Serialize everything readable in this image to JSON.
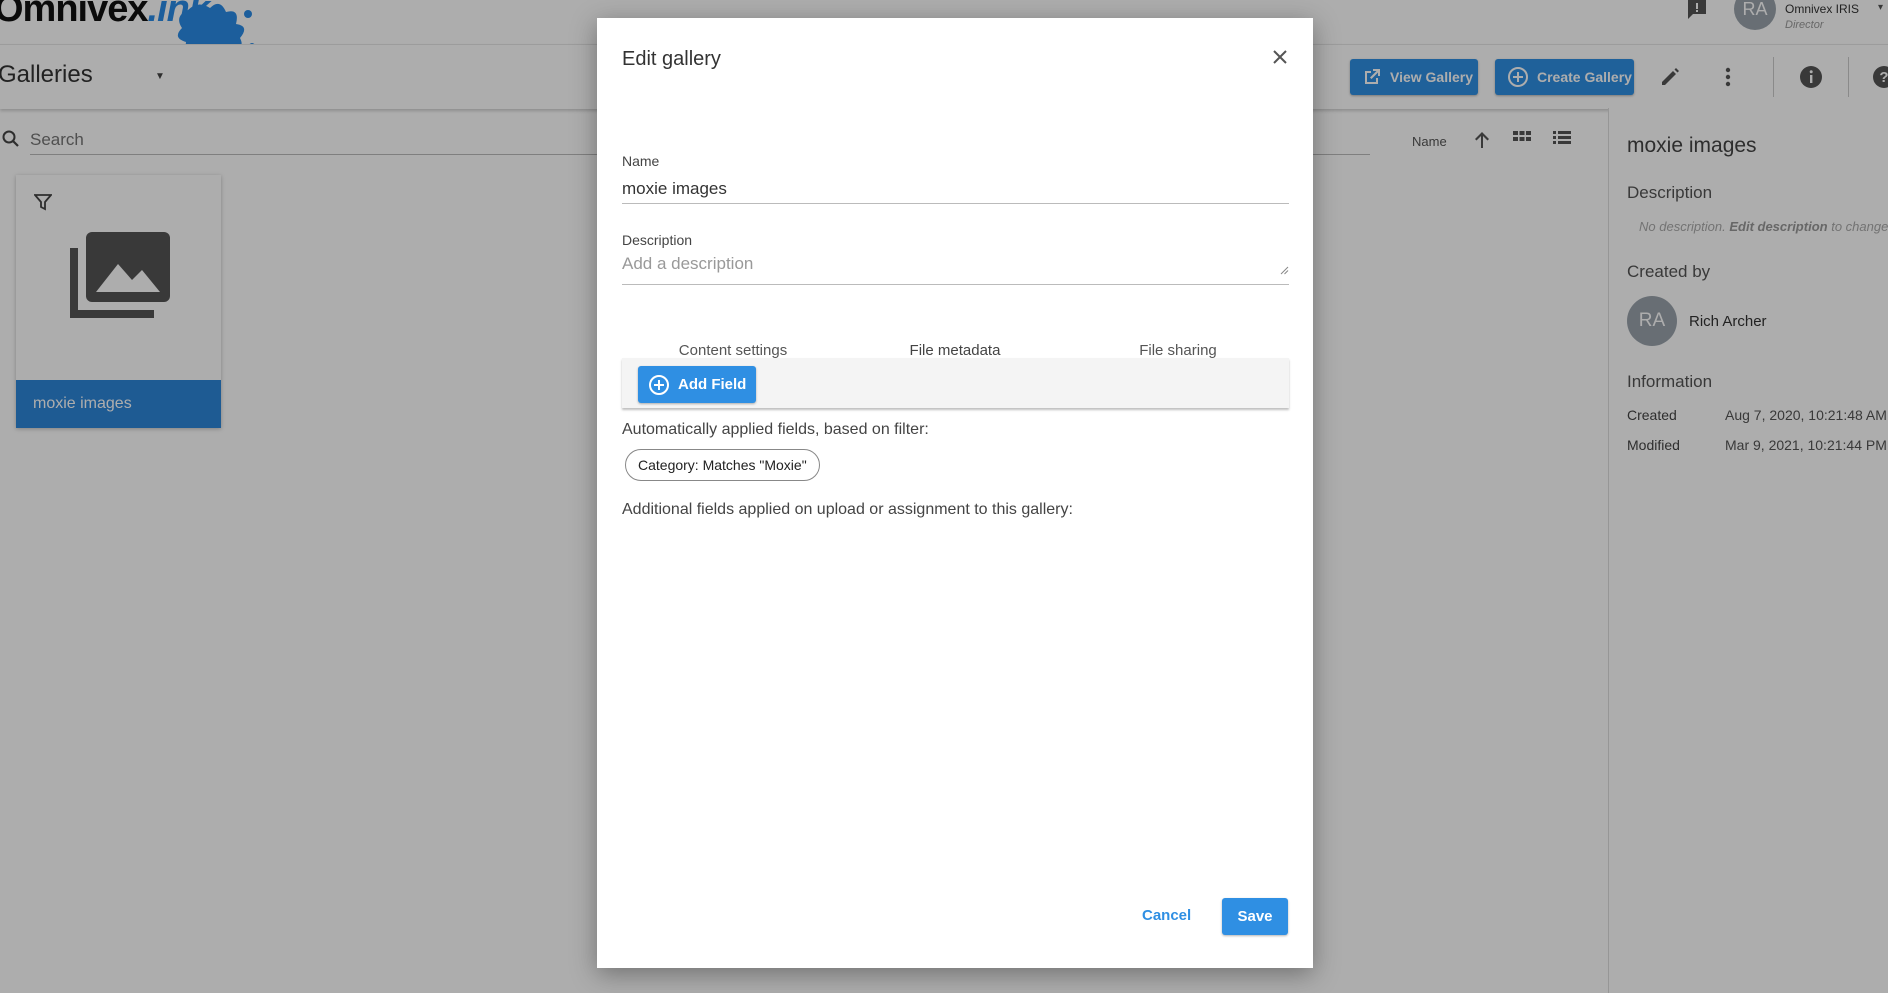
{
  "app": {
    "logo_text": "Omnivex",
    "logo_accent": ".ink",
    "brand_color": "#2f8fe3"
  },
  "user": {
    "initials": "RA",
    "name": "Omnivex IRIS",
    "role": "Director"
  },
  "toolbar": {
    "section": "Galleries",
    "view_gallery": "View Gallery",
    "create_gallery": "Create Gallery",
    "icons": [
      "pencil-icon",
      "more-vertical-icon",
      "info-icon",
      "help-icon"
    ]
  },
  "search": {
    "placeholder": "Search"
  },
  "sort": {
    "label": "Name"
  },
  "gallery_card": {
    "name": "moxie images"
  },
  "details": {
    "title": "moxie images",
    "description_heading": "Description",
    "description_empty": "No description.",
    "description_edit": "Edit description",
    "description_tail": "to change",
    "created_by_heading": "Created by",
    "created_by_initials": "RA",
    "created_by_name": "Rich Archer",
    "information_heading": "Information",
    "created_label": "Created",
    "created_value": "Aug 7, 2020, 10:21:48 AM",
    "modified_label": "Modified",
    "modified_value": "Mar 9, 2021, 10:21:44 PM"
  },
  "modal": {
    "title": "Edit gallery",
    "name_label": "Name",
    "name_value": "moxie images",
    "description_label": "Description",
    "description_placeholder": "Add a description",
    "tabs": [
      "Content settings",
      "File metadata",
      "File sharing"
    ],
    "active_tab": "File metadata",
    "add_field": "Add Field",
    "auto_fields_text": "Automatically applied fields, based on filter:",
    "filter_chip": "Category: Matches \"Moxie\"",
    "additional_fields_text": "Additional fields applied on upload or assignment to this gallery:",
    "cancel": "Cancel",
    "save": "Save"
  }
}
